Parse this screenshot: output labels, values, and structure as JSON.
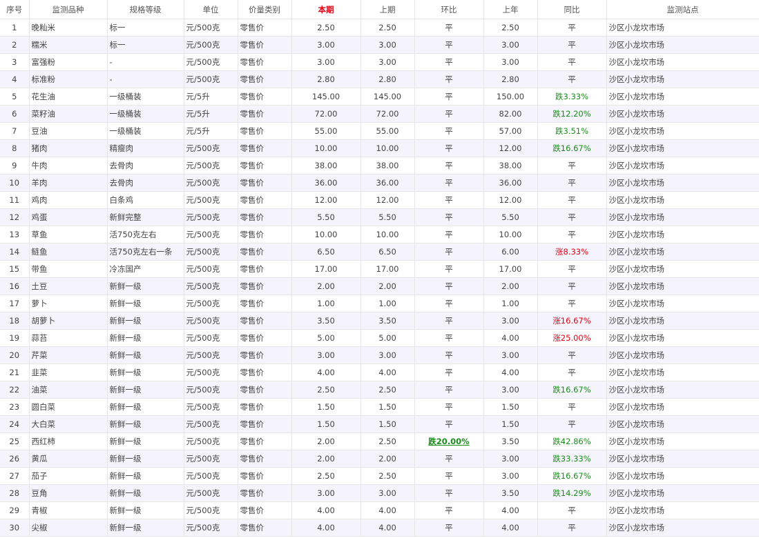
{
  "columns": [
    "序号",
    "监测品种",
    "规格等级",
    "单位",
    "价量类别",
    "本期",
    "上期",
    "环比",
    "上年",
    "同比",
    "监测站点"
  ],
  "rows": [
    [
      "1",
      "晚籼米",
      "标一",
      "元/500克",
      "零售价",
      "2.50",
      "2.50",
      "平",
      "2.50",
      "平",
      "沙区小龙坎市场"
    ],
    [
      "2",
      "糯米",
      "标一",
      "元/500克",
      "零售价",
      "3.00",
      "3.00",
      "平",
      "3.00",
      "平",
      "沙区小龙坎市场"
    ],
    [
      "3",
      "富强粉",
      "-",
      "元/500克",
      "零售价",
      "3.00",
      "3.00",
      "平",
      "3.00",
      "平",
      "沙区小龙坎市场"
    ],
    [
      "4",
      "标准粉",
      "-",
      "元/500克",
      "零售价",
      "2.80",
      "2.80",
      "平",
      "2.80",
      "平",
      "沙区小龙坎市场"
    ],
    [
      "5",
      "花生油",
      "一级桶装",
      "元/5升",
      "零售价",
      "145.00",
      "145.00",
      "平",
      "150.00",
      "跌3.33%",
      "沙区小龙坎市场"
    ],
    [
      "6",
      "菜籽油",
      "一级桶装",
      "元/5升",
      "零售价",
      "72.00",
      "72.00",
      "平",
      "82.00",
      "跌12.20%",
      "沙区小龙坎市场"
    ],
    [
      "7",
      "豆油",
      "一级桶装",
      "元/5升",
      "零售价",
      "55.00",
      "55.00",
      "平",
      "57.00",
      "跌3.51%",
      "沙区小龙坎市场"
    ],
    [
      "8",
      "猪肉",
      "精瘦肉",
      "元/500克",
      "零售价",
      "10.00",
      "10.00",
      "平",
      "12.00",
      "跌16.67%",
      "沙区小龙坎市场"
    ],
    [
      "9",
      "牛肉",
      "去骨肉",
      "元/500克",
      "零售价",
      "38.00",
      "38.00",
      "平",
      "38.00",
      "平",
      "沙区小龙坎市场"
    ],
    [
      "10",
      "羊肉",
      "去骨肉",
      "元/500克",
      "零售价",
      "36.00",
      "36.00",
      "平",
      "36.00",
      "平",
      "沙区小龙坎市场"
    ],
    [
      "11",
      "鸡肉",
      "白条鸡",
      "元/500克",
      "零售价",
      "12.00",
      "12.00",
      "平",
      "12.00",
      "平",
      "沙区小龙坎市场"
    ],
    [
      "12",
      "鸡蛋",
      "新鲜完整",
      "元/500克",
      "零售价",
      "5.50",
      "5.50",
      "平",
      "5.50",
      "平",
      "沙区小龙坎市场"
    ],
    [
      "13",
      "草鱼",
      "活750克左右",
      "元/500克",
      "零售价",
      "10.00",
      "10.00",
      "平",
      "10.00",
      "平",
      "沙区小龙坎市场"
    ],
    [
      "14",
      "鲢鱼",
      "活750克左右一条",
      "元/500克",
      "零售价",
      "6.50",
      "6.50",
      "平",
      "6.00",
      "涨8.33%",
      "沙区小龙坎市场"
    ],
    [
      "15",
      "带鱼",
      "冷冻国产",
      "元/500克",
      "零售价",
      "17.00",
      "17.00",
      "平",
      "17.00",
      "平",
      "沙区小龙坎市场"
    ],
    [
      "16",
      "土豆",
      "新鲜一级",
      "元/500克",
      "零售价",
      "2.00",
      "2.00",
      "平",
      "2.00",
      "平",
      "沙区小龙坎市场"
    ],
    [
      "17",
      "萝卜",
      "新鲜一级",
      "元/500克",
      "零售价",
      "1.00",
      "1.00",
      "平",
      "1.00",
      "平",
      "沙区小龙坎市场"
    ],
    [
      "18",
      "胡萝卜",
      "新鲜一级",
      "元/500克",
      "零售价",
      "3.50",
      "3.50",
      "平",
      "3.00",
      "涨16.67%",
      "沙区小龙坎市场"
    ],
    [
      "19",
      "蒜苔",
      "新鲜一级",
      "元/500克",
      "零售价",
      "5.00",
      "5.00",
      "平",
      "4.00",
      "涨25.00%",
      "沙区小龙坎市场"
    ],
    [
      "20",
      "芹菜",
      "新鲜一级",
      "元/500克",
      "零售价",
      "3.00",
      "3.00",
      "平",
      "3.00",
      "平",
      "沙区小龙坎市场"
    ],
    [
      "21",
      "韭菜",
      "新鲜一级",
      "元/500克",
      "零售价",
      "4.00",
      "4.00",
      "平",
      "4.00",
      "平",
      "沙区小龙坎市场"
    ],
    [
      "22",
      "油菜",
      "新鲜一级",
      "元/500克",
      "零售价",
      "2.50",
      "2.50",
      "平",
      "3.00",
      "跌16.67%",
      "沙区小龙坎市场"
    ],
    [
      "23",
      "圆白菜",
      "新鲜一级",
      "元/500克",
      "零售价",
      "1.50",
      "1.50",
      "平",
      "1.50",
      "平",
      "沙区小龙坎市场"
    ],
    [
      "24",
      "大白菜",
      "新鲜一级",
      "元/500克",
      "零售价",
      "1.50",
      "1.50",
      "平",
      "1.50",
      "平",
      "沙区小龙坎市场"
    ],
    [
      "25",
      "西红柿",
      "新鲜一级",
      "元/500克",
      "零售价",
      "2.00",
      "2.50",
      "跌20.00%",
      "3.50",
      "跌42.86%",
      "沙区小龙坎市场"
    ],
    [
      "26",
      "黄瓜",
      "新鲜一级",
      "元/500克",
      "零售价",
      "2.00",
      "2.00",
      "平",
      "3.00",
      "跌33.33%",
      "沙区小龙坎市场"
    ],
    [
      "27",
      "茄子",
      "新鲜一级",
      "元/500克",
      "零售价",
      "2.50",
      "2.50",
      "平",
      "3.00",
      "跌16.67%",
      "沙区小龙坎市场"
    ],
    [
      "28",
      "豆角",
      "新鲜一级",
      "元/500克",
      "零售价",
      "3.00",
      "3.00",
      "平",
      "3.50",
      "跌14.29%",
      "沙区小龙坎市场"
    ],
    [
      "29",
      "青椒",
      "新鲜一级",
      "元/500克",
      "零售价",
      "4.00",
      "4.00",
      "平",
      "4.00",
      "平",
      "沙区小龙坎市场"
    ],
    [
      "30",
      "尖椒",
      "新鲜一级",
      "元/500克",
      "零售价",
      "4.00",
      "4.00",
      "平",
      "4.00",
      "平",
      "沙区小龙坎市场"
    ]
  ],
  "colors": {
    "rise": "#e60012",
    "fall": "#1a8c1a",
    "row_alt": "#f5f3fb",
    "highlight_header": "#e60012"
  }
}
